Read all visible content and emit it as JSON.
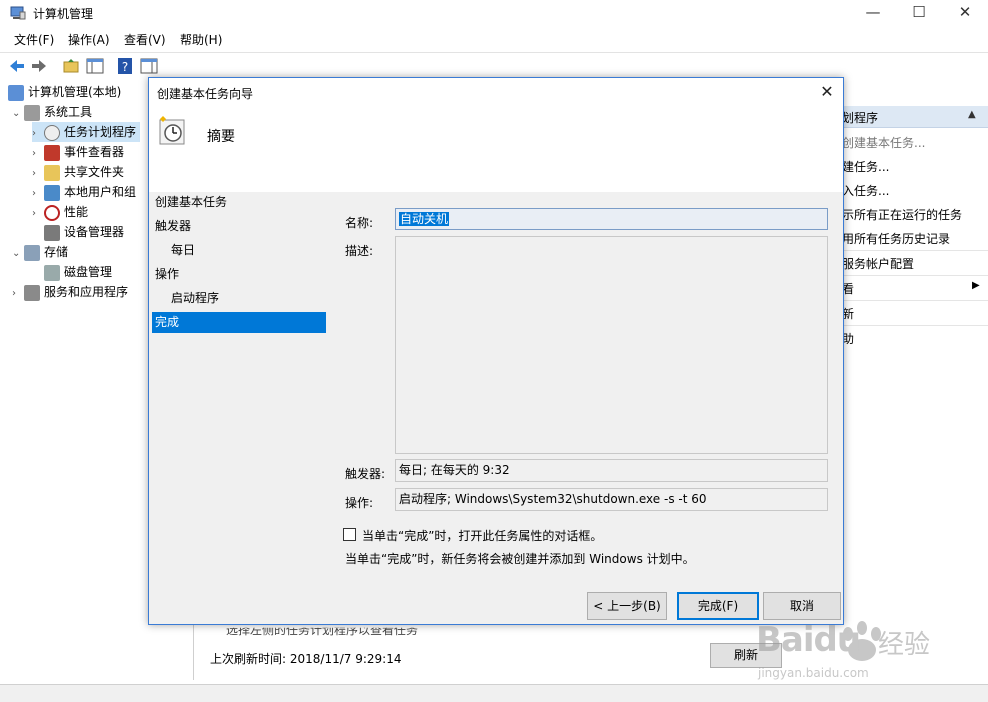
{
  "window": {
    "title": "计算机管理",
    "controls": {
      "minimize": "—",
      "maximize": "☐",
      "close": "✕"
    }
  },
  "menu": [
    "文件(F)",
    "操作(A)",
    "查看(V)",
    "帮助(H)"
  ],
  "tree": {
    "root": "计算机管理(本地)",
    "items": [
      {
        "label": "系统工具",
        "level": 1,
        "arrow": "⌄"
      },
      {
        "label": "任务计划程序",
        "level": 2,
        "arrow": "›"
      },
      {
        "label": "事件查看器",
        "level": 2,
        "arrow": "›"
      },
      {
        "label": "共享文件夹",
        "level": 2,
        "arrow": "›"
      },
      {
        "label": "本地用户和组",
        "level": 2,
        "arrow": "›"
      },
      {
        "label": "性能",
        "level": 2,
        "arrow": "›"
      },
      {
        "label": "设备管理器",
        "level": 2,
        "arrow": ""
      },
      {
        "label": "存储",
        "level": 1,
        "arrow": "⌄"
      },
      {
        "label": "磁盘管理",
        "level": 2,
        "arrow": ""
      },
      {
        "label": "服务和应用程序",
        "level": 1,
        "arrow": "›"
      }
    ]
  },
  "actions": {
    "header": "划程序",
    "items": [
      "创建基本任务...",
      "建任务...",
      "入任务...",
      "示所有正在运行的任务",
      "用所有任务历史记录",
      "服务帐户配置",
      "看",
      "新",
      "助"
    ]
  },
  "bottom": {
    "last_refresh": "上次刷新时间: 2018/11/7 9:29:14",
    "refresh_button": "刷新",
    "partial_text": "选择左侧的任务计划程序以查看任务"
  },
  "dialog": {
    "title": "创建基本任务向导",
    "close": "✕",
    "heading": "摘要",
    "steps": [
      {
        "label": "创建基本任务",
        "indent": 0
      },
      {
        "label": "触发器",
        "indent": 0
      },
      {
        "label": "每日",
        "indent": 1
      },
      {
        "label": "操作",
        "indent": 0
      },
      {
        "label": "启动程序",
        "indent": 1
      },
      {
        "label": "完成",
        "indent": 0,
        "active": true
      }
    ],
    "labels": {
      "name": "名称:",
      "description": "描述:",
      "trigger": "触发器:",
      "action": "操作:"
    },
    "values": {
      "name": "自动关机",
      "description": "",
      "trigger": "每日; 在每天的 9:32",
      "action": "启动程序; Windows\\System32\\shutdown.exe -s -t 60"
    },
    "checkbox_label": "当单击“完成”时，打开此任务属性的对话框。",
    "info_text": "当单击“完成”时，新任务将会被创建并添加到 Windows 计划中。",
    "buttons": {
      "back": "< 上一步(B)",
      "finish": "完成(F)",
      "cancel": "取消"
    }
  },
  "watermark": {
    "brand": "Baidu",
    "brand_cn": "经验",
    "url": "jingyan.baidu.com"
  },
  "colors": {
    "accent": "#0078d7",
    "dialog_border": "#3a7bd5"
  }
}
